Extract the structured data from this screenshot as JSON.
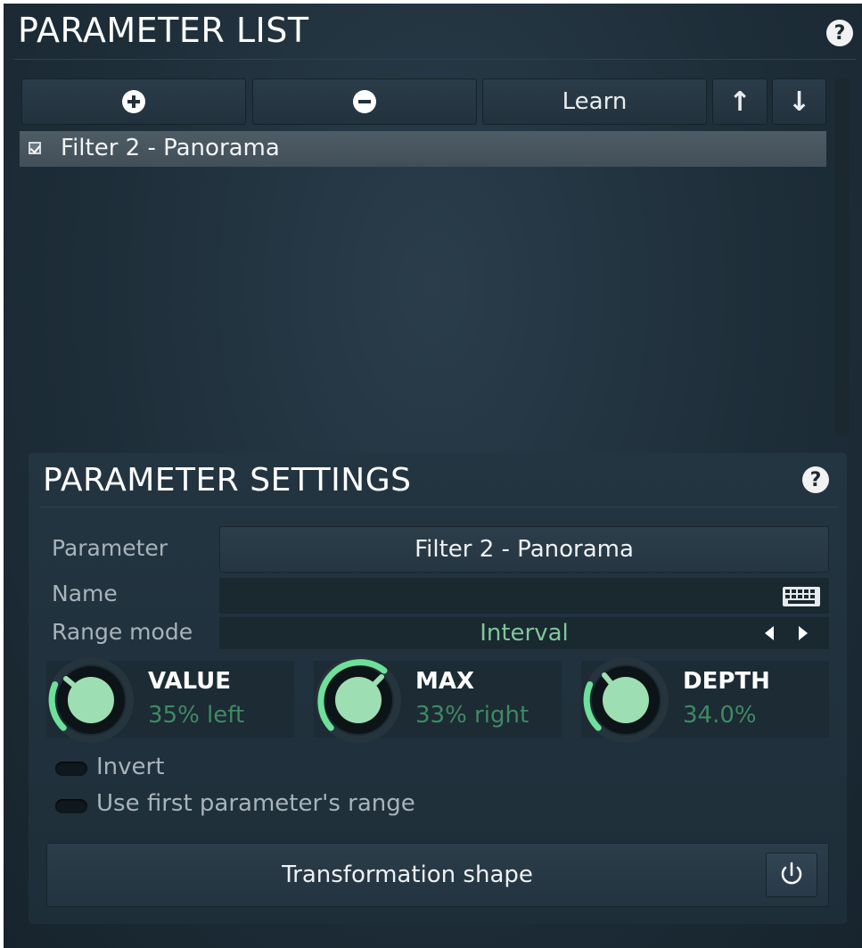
{
  "parameter_list": {
    "title": "PARAMETER LIST",
    "help": "?",
    "toolbar": {
      "learn_label": "Learn",
      "up_arrow": "↑",
      "down_arrow": "↓"
    },
    "items": [
      {
        "label": "Filter 2 - Panorama",
        "checked": true,
        "selected": true
      }
    ]
  },
  "parameter_settings": {
    "title": "PARAMETER SETTINGS",
    "help": "?",
    "parameter_label": "Parameter",
    "parameter_value": "Filter 2 - Panorama",
    "name_label": "Name",
    "name_value": "",
    "range_mode_label": "Range mode",
    "range_mode_value": "Interval",
    "knobs": [
      {
        "name": "VALUE",
        "display": "35% left"
      },
      {
        "name": "MAX",
        "display": "33% right"
      },
      {
        "name": "DEPTH",
        "display": "34.0%"
      }
    ],
    "invert_label": "Invert",
    "use_first_range_label": "Use first parameter's range",
    "transformation_shape_label": "Transformation shape"
  },
  "colors": {
    "accent_green": "#7fc69a",
    "value_green": "#3f8a63",
    "panel_bg": "#1e2e39"
  },
  "icons": [
    "plus-icon",
    "minus-icon",
    "up-arrow-icon",
    "down-arrow-icon",
    "checkbox-icon",
    "keyboard-icon",
    "left-triangle-icon",
    "right-triangle-icon",
    "power-icon",
    "help-icon"
  ]
}
